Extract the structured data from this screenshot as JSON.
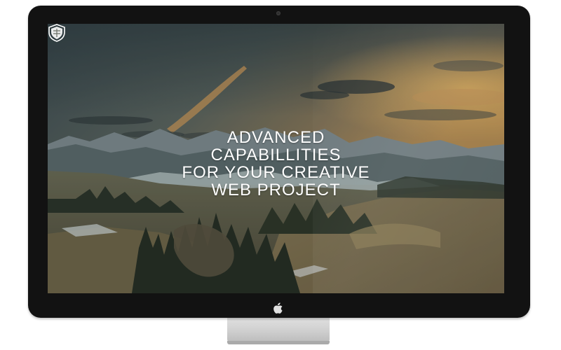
{
  "device": {
    "type": "desktop-monitor",
    "brand_icon": "apple-logo-icon",
    "bezel_color": "#121212",
    "stand_color": "#d4d4d4"
  },
  "hero": {
    "crest_icon": "shield-crest-icon",
    "headline_lines": [
      "ADVANCED",
      "CAPABILLITIES",
      "FOR YOUR CREATIVE",
      "WEB PROJECT"
    ],
    "subline": "",
    "background": "mountain-landscape-at-sunset",
    "text_color": "#ffffff"
  }
}
